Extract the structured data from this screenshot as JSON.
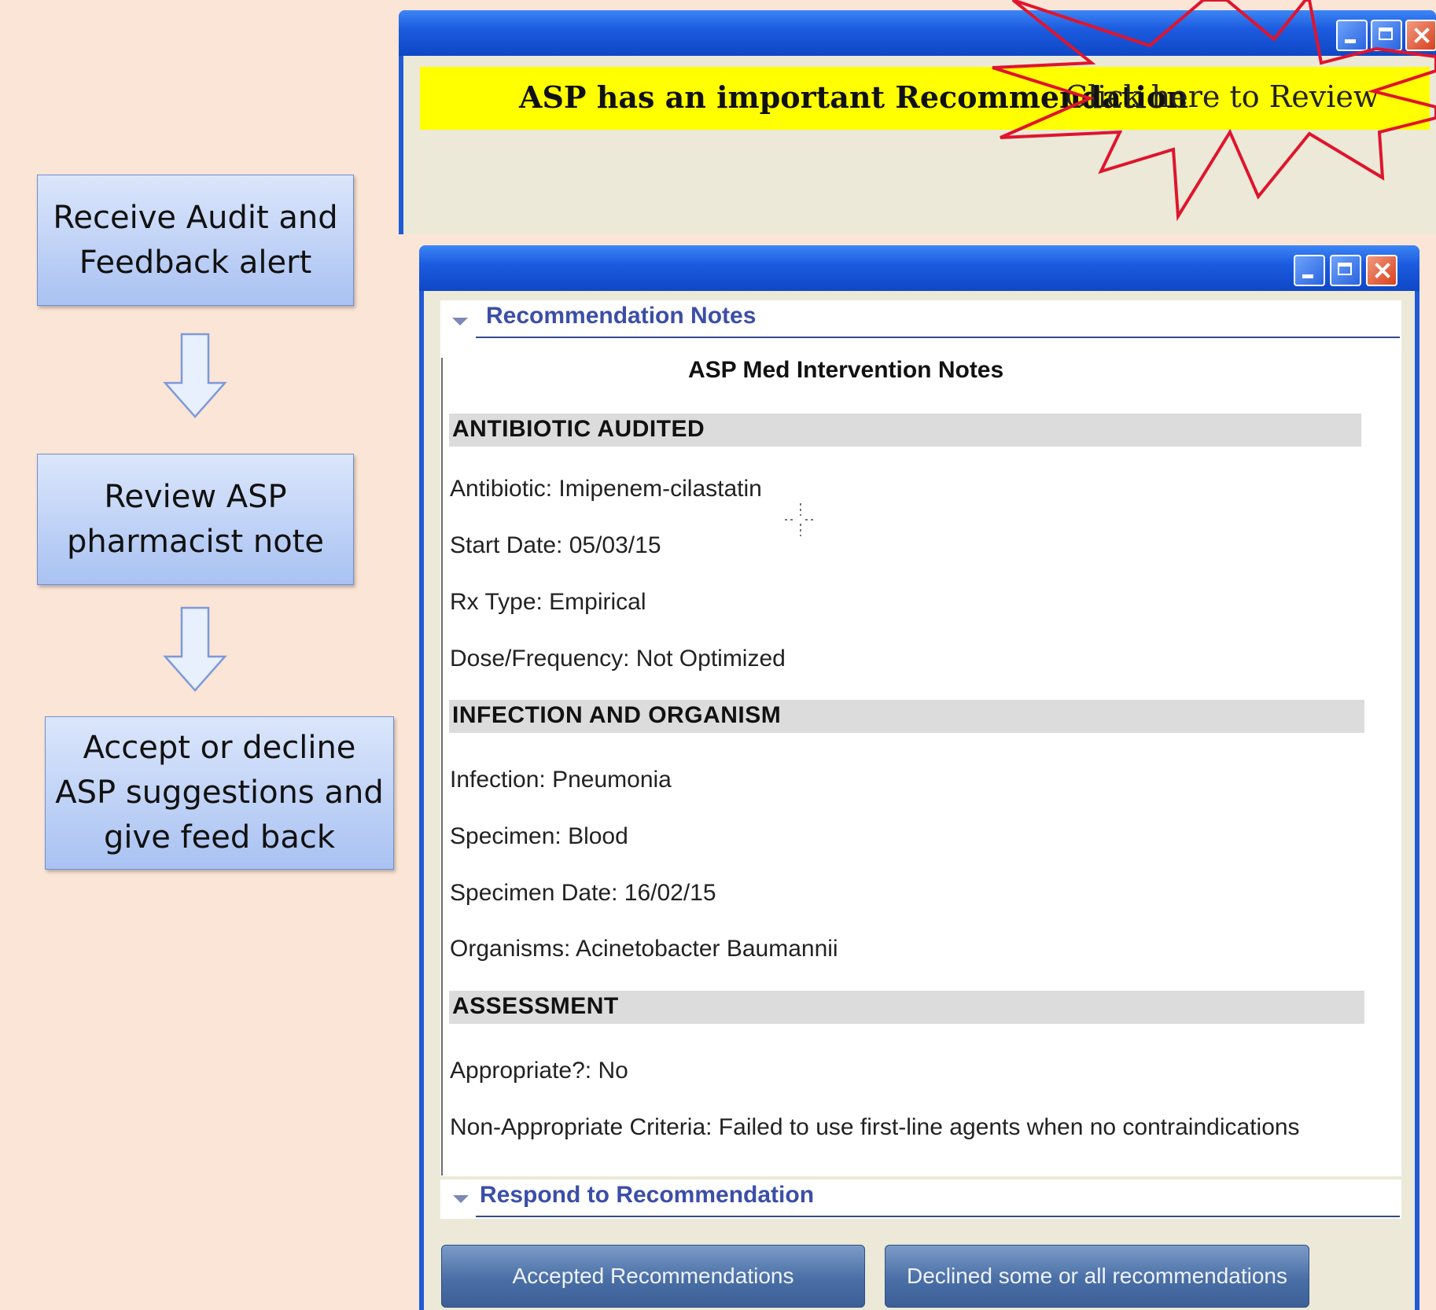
{
  "flow": {
    "step1": [
      "Receive Audit and",
      "Feedback alert"
    ],
    "step2": [
      "Review ASP",
      "pharmacist note"
    ],
    "step3": [
      "Accept or decline",
      "ASP suggestions and",
      "give feed back"
    ]
  },
  "alert_window": {
    "message_bold": "ASP has an important Recommendation",
    "message_link": "Click here to Review"
  },
  "notes_window": {
    "section_recommendation": "Recommendation Notes",
    "note_title": "ASP Med Intervention Notes",
    "antibiotic_heading": "ANTIBIOTIC AUDITED",
    "antibiotic": "Antibiotic: Imipenem-cilastatin",
    "start_date": "Start Date: 05/03/15",
    "rx_type": "Rx Type: Empirical",
    "dose": "Dose/Frequency: Not Optimized",
    "infection_heading": "INFECTION AND ORGANISM",
    "infection": "Infection: Pneumonia",
    "specimen": "Specimen: Blood",
    "specimen_date": "Specimen Date: 16/02/15",
    "organisms": "Organisms: Acinetobacter Baumannii",
    "assessment_heading": "ASSESSMENT",
    "appropriate": "Appropriate?: No",
    "criteria": "Non-Appropriate Criteria: Failed to use first-line agents when no contraindications",
    "section_respond": "Respond to Recommendation",
    "accept_button": "Accepted Recommendations",
    "decline_button": "Declined some or all recommendations"
  },
  "colors": {
    "background": "#fbe5d6",
    "flow_box": "#b8cdf5",
    "titlebar": "#1d5ce0",
    "alert_highlight": "#ffff00",
    "starburst": "#e0142d",
    "section_heading": "#3b4ea8",
    "button": "#4a6fa6"
  },
  "icons": [
    "arrow-down-icon",
    "minimize-icon",
    "maximize-icon",
    "close-icon",
    "starburst-icon",
    "collapse-triangle-icon",
    "cursor-crosshair-icon"
  ]
}
